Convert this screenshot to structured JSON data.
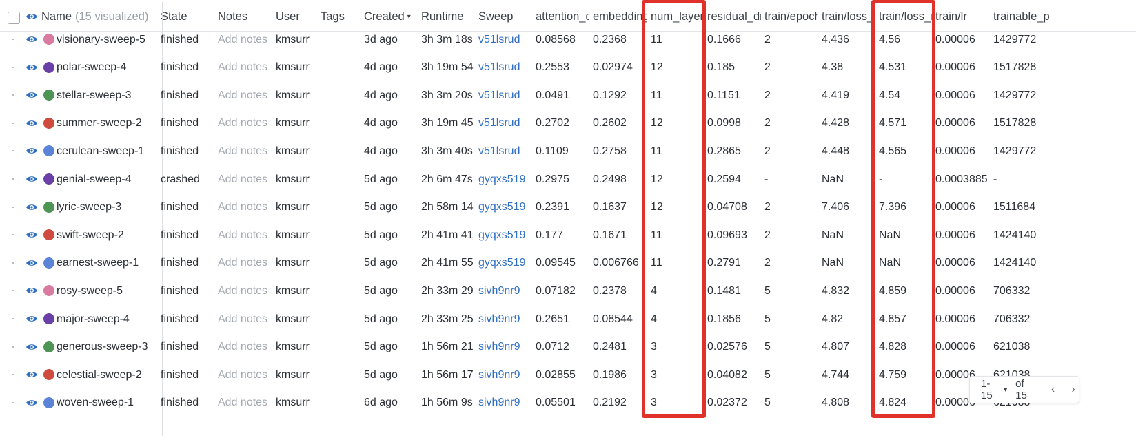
{
  "header": {
    "name_label": "Name",
    "name_count": "(15 visualized)",
    "columns": [
      "State",
      "Notes",
      "User",
      "Tags",
      "Created",
      "Runtime",
      "Sweep",
      "attention_d",
      "embedding",
      "num_layers",
      "residual_dr",
      "train/epoch",
      "train/loss_b",
      "train/loss_r",
      "train/lr",
      "trainable_p"
    ]
  },
  "rows": [
    {
      "name": "visionary-sweep-5",
      "color": "#d97aa0",
      "state": "finished",
      "notes": "Add notes",
      "user": "kmsurr",
      "tags": "",
      "created": "3d ago",
      "runtime": "3h 3m 18s",
      "sweep": "v51lsrud",
      "attention_d": "0.08568",
      "embedding": "0.2368",
      "num_layers": "11",
      "residual_dr": "0.1666",
      "epoch": "2",
      "loss_b": "4.436",
      "loss_r": "4.56",
      "lr": "0.00006",
      "trainable_p": "1429772"
    },
    {
      "name": "polar-sweep-4",
      "color": "#6a3fa8",
      "state": "finished",
      "notes": "Add notes",
      "user": "kmsurr",
      "tags": "",
      "created": "4d ago",
      "runtime": "3h 19m 54",
      "sweep": "v51lsrud",
      "attention_d": "0.2553",
      "embedding": "0.02974",
      "num_layers": "12",
      "residual_dr": "0.185",
      "epoch": "2",
      "loss_b": "4.38",
      "loss_r": "4.531",
      "lr": "0.00006",
      "trainable_p": "1517828"
    },
    {
      "name": "stellar-sweep-3",
      "color": "#4e9455",
      "state": "finished",
      "notes": "Add notes",
      "user": "kmsurr",
      "tags": "",
      "created": "4d ago",
      "runtime": "3h 3m 20s",
      "sweep": "v51lsrud",
      "attention_d": "0.0491",
      "embedding": "0.1292",
      "num_layers": "11",
      "residual_dr": "0.1151",
      "epoch": "2",
      "loss_b": "4.419",
      "loss_r": "4.54",
      "lr": "0.00006",
      "trainable_p": "1429772"
    },
    {
      "name": "summer-sweep-2",
      "color": "#cf4a3f",
      "state": "finished",
      "notes": "Add notes",
      "user": "kmsurr",
      "tags": "",
      "created": "4d ago",
      "runtime": "3h 19m 45",
      "sweep": "v51lsrud",
      "attention_d": "0.2702",
      "embedding": "0.2602",
      "num_layers": "12",
      "residual_dr": "0.0998",
      "epoch": "2",
      "loss_b": "4.428",
      "loss_r": "4.571",
      "lr": "0.00006",
      "trainable_p": "1517828"
    },
    {
      "name": "cerulean-sweep-1",
      "color": "#5b84d8",
      "state": "finished",
      "notes": "Add notes",
      "user": "kmsurr",
      "tags": "",
      "created": "4d ago",
      "runtime": "3h 3m 40s",
      "sweep": "v51lsrud",
      "attention_d": "0.1109",
      "embedding": "0.2758",
      "num_layers": "11",
      "residual_dr": "0.2865",
      "epoch": "2",
      "loss_b": "4.448",
      "loss_r": "4.565",
      "lr": "0.00006",
      "trainable_p": "1429772"
    },
    {
      "name": "genial-sweep-4",
      "color": "#6a3fa8",
      "state": "crashed",
      "notes": "Add notes",
      "user": "kmsurr",
      "tags": "",
      "created": "5d ago",
      "runtime": "2h 6m 47s",
      "sweep": "gyqxs519",
      "attention_d": "0.2975",
      "embedding": "0.2498",
      "num_layers": "12",
      "residual_dr": "0.2594",
      "epoch": "-",
      "loss_b": "NaN",
      "loss_r": "-",
      "lr": "0.0003885",
      "trainable_p": "-"
    },
    {
      "name": "lyric-sweep-3",
      "color": "#4e9455",
      "state": "finished",
      "notes": "Add notes",
      "user": "kmsurr",
      "tags": "",
      "created": "5d ago",
      "runtime": "2h 58m 14",
      "sweep": "gyqxs519",
      "attention_d": "0.2391",
      "embedding": "0.1637",
      "num_layers": "12",
      "residual_dr": "0.04708",
      "epoch": "2",
      "loss_b": "7.406",
      "loss_r": "7.396",
      "lr": "0.00006",
      "trainable_p": "1511684"
    },
    {
      "name": "swift-sweep-2",
      "color": "#cf4a3f",
      "state": "finished",
      "notes": "Add notes",
      "user": "kmsurr",
      "tags": "",
      "created": "5d ago",
      "runtime": "2h 41m 41",
      "sweep": "gyqxs519",
      "attention_d": "0.177",
      "embedding": "0.1671",
      "num_layers": "11",
      "residual_dr": "0.09693",
      "epoch": "2",
      "loss_b": "NaN",
      "loss_r": "NaN",
      "lr": "0.00006",
      "trainable_p": "1424140"
    },
    {
      "name": "earnest-sweep-1",
      "color": "#5b84d8",
      "state": "finished",
      "notes": "Add notes",
      "user": "kmsurr",
      "tags": "",
      "created": "5d ago",
      "runtime": "2h 41m 55",
      "sweep": "gyqxs519",
      "attention_d": "0.09545",
      "embedding": "0.006766",
      "num_layers": "11",
      "residual_dr": "0.2791",
      "epoch": "2",
      "loss_b": "NaN",
      "loss_r": "NaN",
      "lr": "0.00006",
      "trainable_p": "1424140"
    },
    {
      "name": "rosy-sweep-5",
      "color": "#d97aa0",
      "state": "finished",
      "notes": "Add notes",
      "user": "kmsurr",
      "tags": "",
      "created": "5d ago",
      "runtime": "2h 33m 29",
      "sweep": "sivh9nr9",
      "attention_d": "0.07182",
      "embedding": "0.2378",
      "num_layers": "4",
      "residual_dr": "0.1481",
      "epoch": "5",
      "loss_b": "4.832",
      "loss_r": "4.859",
      "lr": "0.00006",
      "trainable_p": "706332"
    },
    {
      "name": "major-sweep-4",
      "color": "#6a3fa8",
      "state": "finished",
      "notes": "Add notes",
      "user": "kmsurr",
      "tags": "",
      "created": "5d ago",
      "runtime": "2h 33m 25",
      "sweep": "sivh9nr9",
      "attention_d": "0.2651",
      "embedding": "0.08544",
      "num_layers": "4",
      "residual_dr": "0.1856",
      "epoch": "5",
      "loss_b": "4.82",
      "loss_r": "4.857",
      "lr": "0.00006",
      "trainable_p": "706332"
    },
    {
      "name": "generous-sweep-3",
      "color": "#4e9455",
      "state": "finished",
      "notes": "Add notes",
      "user": "kmsurr",
      "tags": "",
      "created": "5d ago",
      "runtime": "1h 56m 21",
      "sweep": "sivh9nr9",
      "attention_d": "0.0712",
      "embedding": "0.2481",
      "num_layers": "3",
      "residual_dr": "0.02576",
      "epoch": "5",
      "loss_b": "4.807",
      "loss_r": "4.828",
      "lr": "0.00006",
      "trainable_p": "621038"
    },
    {
      "name": "celestial-sweep-2",
      "color": "#cf4a3f",
      "state": "finished",
      "notes": "Add notes",
      "user": "kmsurr",
      "tags": "",
      "created": "5d ago",
      "runtime": "1h 56m 17",
      "sweep": "sivh9nr9",
      "attention_d": "0.02855",
      "embedding": "0.1986",
      "num_layers": "3",
      "residual_dr": "0.04082",
      "epoch": "5",
      "loss_b": "4.744",
      "loss_r": "4.759",
      "lr": "0.00006",
      "trainable_p": "621038"
    },
    {
      "name": "woven-sweep-1",
      "color": "#5b84d8",
      "state": "finished",
      "notes": "Add notes",
      "user": "kmsurr",
      "tags": "",
      "created": "6d ago",
      "runtime": "1h 56m 9s",
      "sweep": "sivh9nr9",
      "attention_d": "0.05501",
      "embedding": "0.2192",
      "num_layers": "3",
      "residual_dr": "0.02372",
      "epoch": "5",
      "loss_b": "4.808",
      "loss_r": "4.824",
      "lr": "0.00006",
      "trainable_p": "621038"
    }
  ],
  "pager": {
    "range": "1-15",
    "of": "of 15"
  },
  "colors": {
    "highlight": "#e0322b",
    "link": "#2f6fc2",
    "notes_placeholder": "#a4a9b0"
  }
}
